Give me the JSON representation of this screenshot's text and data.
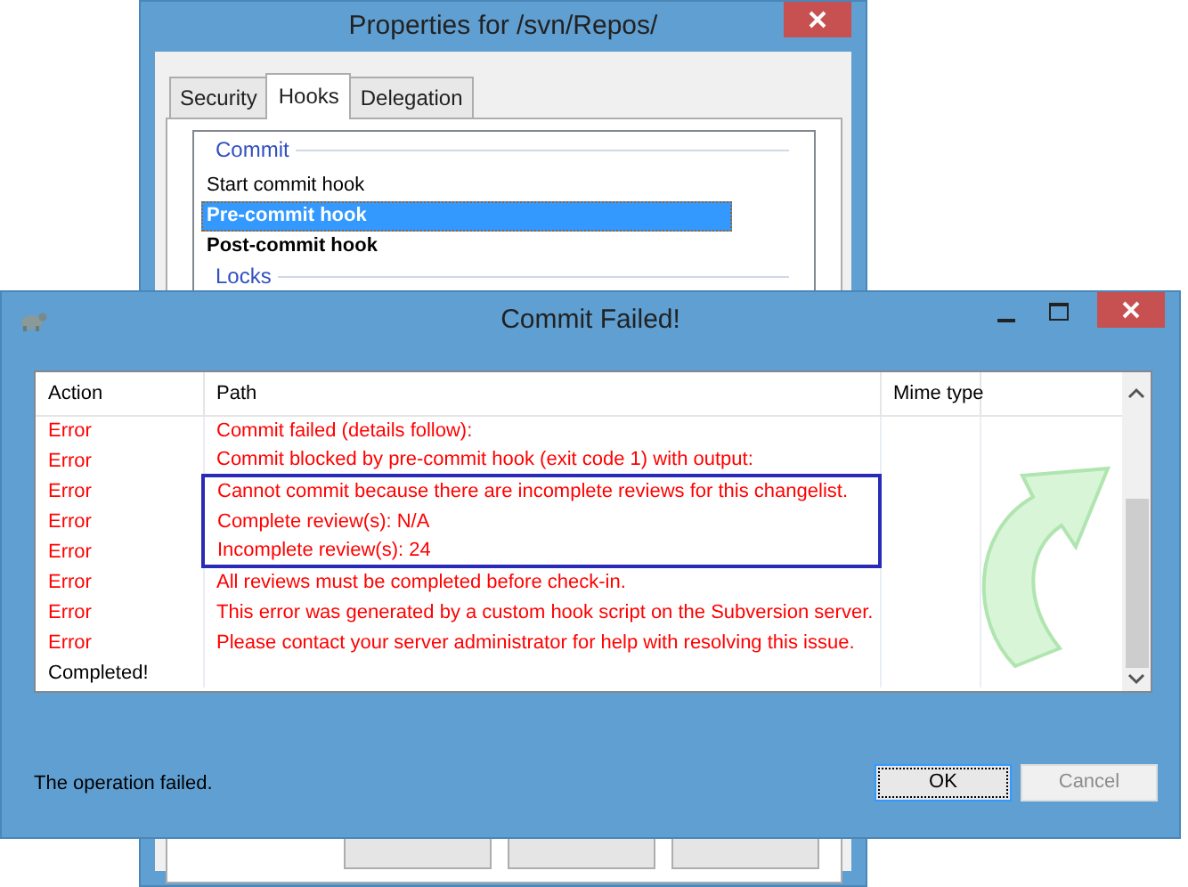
{
  "properties_window": {
    "title": "Properties for /svn/Repos/",
    "tabs": [
      {
        "label": "Security",
        "selected": false
      },
      {
        "label": "Hooks",
        "selected": true
      },
      {
        "label": "Delegation",
        "selected": false
      }
    ],
    "commit_group": {
      "title": "Commit",
      "hooks": [
        {
          "label": "Start commit hook",
          "selected": false,
          "configured": false
        },
        {
          "label": "Pre-commit hook",
          "selected": true,
          "configured": true
        },
        {
          "label": "Post-commit hook",
          "selected": false,
          "configured": true
        }
      ]
    },
    "locks_group": {
      "title": "Locks"
    }
  },
  "commit_window": {
    "title": "Commit Failed!",
    "columns": [
      "Action",
      "Path",
      "Mime type"
    ],
    "rows": [
      {
        "kind": "error",
        "action": "Error",
        "path": "Commit failed (details follow):",
        "highlighted": false
      },
      {
        "kind": "error",
        "action": "Error",
        "path": "Commit blocked by pre-commit hook (exit code 1) with output:",
        "highlighted": false
      },
      {
        "kind": "error",
        "action": "Error",
        "path": "Cannot commit because there are incomplete reviews for this changelist.",
        "highlighted": true
      },
      {
        "kind": "error",
        "action": "Error",
        "path": "Complete review(s):  N/A",
        "highlighted": true
      },
      {
        "kind": "error",
        "action": "Error",
        "path": "Incomplete review(s):  24",
        "highlighted": true
      },
      {
        "kind": "error",
        "action": "Error",
        "path": "All reviews must be completed before check-in.",
        "highlighted": false
      },
      {
        "kind": "error",
        "action": "Error",
        "path": "This error was generated by a custom hook script on the Subversion server.",
        "highlighted": false
      },
      {
        "kind": "error",
        "action": "Error",
        "path": "Please contact your server administrator for help with resolving this issue.",
        "highlighted": false
      },
      {
        "kind": "done",
        "action": "Completed!",
        "path": "",
        "highlighted": false
      }
    ],
    "status": "The operation failed.",
    "buttons": [
      {
        "label": "OK",
        "disabled": false,
        "default": true
      },
      {
        "label": "Cancel",
        "disabled": true,
        "default": false
      }
    ]
  }
}
